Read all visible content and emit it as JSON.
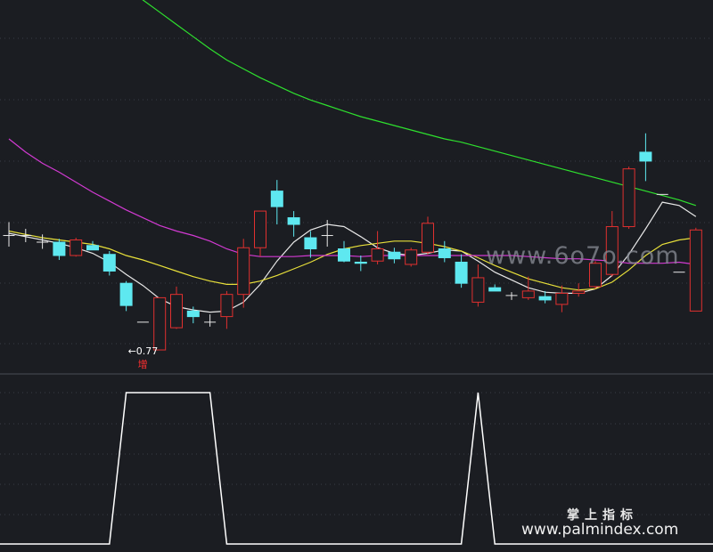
{
  "watermarks": {
    "top": "www.6o7o.com",
    "cn": "掌上指标",
    "url": "www.palmindex.com"
  },
  "colors": {
    "background": "#1b1d22",
    "grid": "#3a3d45",
    "up": "#e0302f",
    "down": "#5ee8f0",
    "ma_white": "#e8e8e8",
    "ma_yellow": "#e8e03a",
    "ma_magenta": "#d23ad2",
    "ma_green": "#2ee02e",
    "indicator": "#ffffff",
    "annotation": "#ffffff",
    "signal_text": "#ff3030"
  },
  "chart_data": [
    {
      "type": "candlestick",
      "panel": "price",
      "ylim": [
        -3.5,
        30
      ],
      "grid": true,
      "candles": [
        {
          "o": 8.8,
          "h": 10.0,
          "l": 7.8,
          "c": 8.8
        },
        {
          "o": 8.8,
          "h": 9.4,
          "l": 8.2,
          "c": 8.8
        },
        {
          "o": 8.2,
          "h": 8.9,
          "l": 7.6,
          "c": 8.2
        },
        {
          "o": 8.2,
          "h": 8.5,
          "l": 6.6,
          "c": 7.0
        },
        {
          "o": 7.0,
          "h": 8.6,
          "l": 6.9,
          "c": 8.4
        },
        {
          "o": 7.9,
          "h": 8.3,
          "l": 7.5,
          "c": 7.5
        },
        {
          "o": 7.1,
          "h": 7.4,
          "l": 5.2,
          "c": 5.6
        },
        {
          "o": 4.5,
          "h": 4.7,
          "l": 2.0,
          "c": 2.5
        },
        {
          "o": 1.0,
          "h": 1.0,
          "l": 1.0,
          "c": 1.0
        },
        {
          "o": -1.5,
          "h": 3.2,
          "l": -1.5,
          "c": 3.2
        },
        {
          "o": 0.5,
          "h": 4.2,
          "l": 0.4,
          "c": 3.5
        },
        {
          "o": 2.0,
          "h": 2.4,
          "l": 0.9,
          "c": 1.5
        },
        {
          "o": 1.0,
          "h": 1.7,
          "l": 0.6,
          "c": 1.0
        },
        {
          "o": 1.5,
          "h": 3.8,
          "l": 0.4,
          "c": 3.5
        },
        {
          "o": 3.5,
          "h": 8.5,
          "l": 2.3,
          "c": 7.7
        },
        {
          "o": 7.7,
          "h": 10.6,
          "l": 6.9,
          "c": 11.0
        },
        {
          "o": 12.8,
          "h": 13.8,
          "l": 9.8,
          "c": 11.4
        },
        {
          "o": 10.4,
          "h": 11.0,
          "l": 8.7,
          "c": 9.8
        },
        {
          "o": 8.6,
          "h": 9.2,
          "l": 6.8,
          "c": 7.6
        },
        {
          "o": 8.8,
          "h": 10.2,
          "l": 7.8,
          "c": 8.8
        },
        {
          "o": 7.6,
          "h": 8.3,
          "l": 6.4,
          "c": 6.5
        },
        {
          "o": 6.4,
          "h": 7.0,
          "l": 5.6,
          "c": 6.3
        },
        {
          "o": 6.5,
          "h": 9.2,
          "l": 6.2,
          "c": 7.6
        },
        {
          "o": 7.3,
          "h": 7.7,
          "l": 6.3,
          "c": 6.7
        },
        {
          "o": 6.2,
          "h": 7.7,
          "l": 6.0,
          "c": 7.5
        },
        {
          "o": 7.3,
          "h": 10.5,
          "l": 7.1,
          "c": 9.9
        },
        {
          "o": 7.6,
          "h": 8.3,
          "l": 6.4,
          "c": 6.8
        },
        {
          "o": 6.4,
          "h": 7.1,
          "l": 4.1,
          "c": 4.5
        },
        {
          "o": 2.8,
          "h": 6.2,
          "l": 2.4,
          "c": 5.0
        },
        {
          "o": 4.1,
          "h": 4.4,
          "l": 3.8,
          "c": 3.8
        },
        {
          "o": 3.4,
          "h": 3.7,
          "l": 3.0,
          "c": 3.4
        },
        {
          "o": 3.2,
          "h": 5.1,
          "l": 3.0,
          "c": 3.8
        },
        {
          "o": 3.3,
          "h": 3.8,
          "l": 2.7,
          "c": 3.0
        },
        {
          "o": 2.6,
          "h": 4.3,
          "l": 1.9,
          "c": 3.6
        },
        {
          "o": 3.6,
          "h": 4.5,
          "l": 3.3,
          "c": 3.8
        },
        {
          "o": 4.2,
          "h": 6.5,
          "l": 4.0,
          "c": 6.3
        },
        {
          "o": 5.3,
          "h": 11.0,
          "l": 5.1,
          "c": 9.6
        },
        {
          "o": 9.6,
          "h": 15.0,
          "l": 9.4,
          "c": 14.8
        },
        {
          "o": 16.3,
          "h": 18.0,
          "l": 13.7,
          "c": 15.5
        },
        {
          "o": 12.5,
          "h": 12.5,
          "l": 12.5,
          "c": 12.5
        },
        {
          "o": 5.5,
          "h": 5.5,
          "l": 5.5,
          "c": 5.5
        },
        {
          "o": 2.0,
          "h": 9.5,
          "l": 2.0,
          "c": 9.3
        }
      ],
      "series": [
        {
          "color": "#e8e8e8",
          "values": [
            9.0,
            8.7,
            8.4,
            8.1,
            7.7,
            7.2,
            6.4,
            5.3,
            4.3,
            3.1,
            2.4,
            2.1,
            1.9,
            2.0,
            2.8,
            4.4,
            6.5,
            8.2,
            9.3,
            9.8,
            9.6,
            8.7,
            7.7,
            7.2,
            7.0,
            7.2,
            7.5,
            7.4,
            6.5,
            5.5,
            4.8,
            4.1,
            3.7,
            3.6,
            3.6,
            4.0,
            5.2,
            7.1,
            9.4,
            11.8,
            11.5,
            10.5
          ]
        },
        {
          "color": "#e8e03a",
          "values": [
            9.2,
            8.9,
            8.6,
            8.4,
            8.2,
            8.0,
            7.6,
            7.0,
            6.6,
            6.1,
            5.6,
            5.1,
            4.7,
            4.4,
            4.4,
            4.7,
            5.2,
            5.8,
            6.4,
            7.1,
            7.6,
            7.9,
            8.1,
            8.3,
            8.3,
            8.1,
            7.8,
            7.4,
            6.8,
            6.1,
            5.5,
            4.9,
            4.5,
            4.1,
            3.9,
            4.0,
            4.6,
            5.7,
            7.0,
            8.0,
            8.4,
            8.6
          ]
        },
        {
          "color": "#d23ad2",
          "values": [
            17.5,
            16.3,
            15.3,
            14.5,
            13.6,
            12.7,
            11.9,
            11.1,
            10.4,
            9.7,
            9.2,
            8.8,
            8.3,
            7.6,
            7.1,
            6.9,
            6.9,
            6.9,
            7.0,
            7.0,
            7.0,
            6.9,
            7.0,
            7.0,
            7.0,
            7.0,
            7.0,
            7.0,
            7.0,
            7.0,
            7.0,
            6.9,
            6.8,
            6.7,
            6.7,
            6.6,
            6.5,
            6.3,
            6.3,
            6.3,
            6.4,
            6.2
          ]
        },
        {
          "color": "#2ee02e",
          "values": [
            37.2,
            36.5,
            35.7,
            34.9,
            34.1,
            33.2,
            32.2,
            31.2,
            30.0,
            28.9,
            27.8,
            26.7,
            25.6,
            24.6,
            23.8,
            23.0,
            22.3,
            21.6,
            21.0,
            20.5,
            20.0,
            19.5,
            19.1,
            18.7,
            18.3,
            17.9,
            17.5,
            17.2,
            16.8,
            16.4,
            16.0,
            15.6,
            15.2,
            14.8,
            14.4,
            14.0,
            13.6,
            13.2,
            12.8,
            12.4,
            12.0,
            11.5
          ]
        }
      ],
      "annotations": [
        {
          "index": 7,
          "value": -1.5,
          "label": "←0.77",
          "signal": "增"
        }
      ]
    },
    {
      "type": "line",
      "panel": "indicator",
      "ylim": [
        0,
        1
      ],
      "grid": true,
      "series": [
        {
          "color": "#ffffff",
          "values": [
            0,
            0,
            0,
            0,
            0,
            0,
            0,
            1,
            1,
            1,
            1,
            1,
            1,
            0,
            0,
            0,
            0,
            0,
            0,
            0,
            0,
            0,
            0,
            0,
            0,
            0,
            0,
            0,
            1,
            0,
            0,
            0,
            0,
            0,
            0,
            0,
            0,
            0,
            0,
            0,
            0,
            0
          ]
        }
      ]
    }
  ]
}
